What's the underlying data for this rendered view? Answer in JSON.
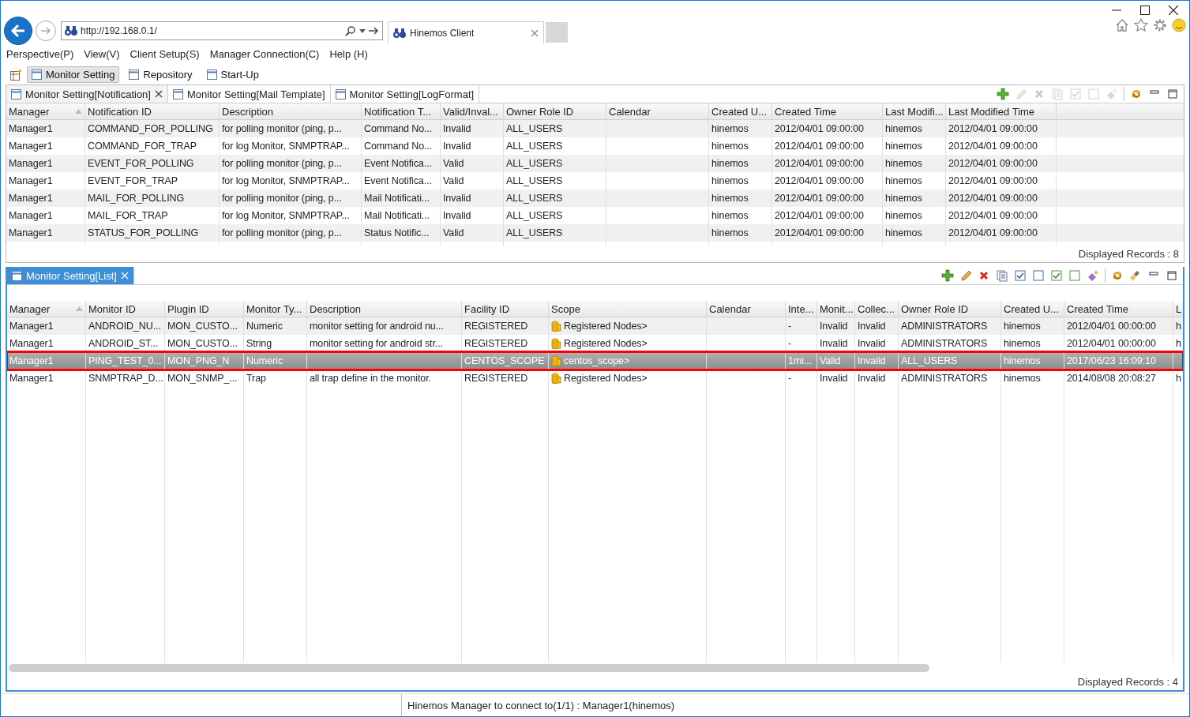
{
  "browser": {
    "url": "http://192.168.0.1/",
    "tab": {
      "title": "Hinemos Client"
    }
  },
  "menu": [
    "Perspective(P)",
    "View(V)",
    "Client Setup(S)",
    "Manager Connection(C)",
    "Help (H)"
  ],
  "perspectives": [
    {
      "label": "Monitor Setting",
      "selected": true
    },
    {
      "label": "Repository",
      "selected": false
    },
    {
      "label": "Start-Up",
      "selected": false
    }
  ],
  "top_view": {
    "active": false,
    "tabs": [
      {
        "label": "Monitor Setting[Notification]",
        "selected": true,
        "closable": true
      },
      {
        "label": "Monitor Setting[Mail Template]",
        "selected": false,
        "closable": false
      },
      {
        "label": "Monitor Setting[LogFormat]",
        "selected": false,
        "closable": false
      }
    ],
    "toolbar": [
      {
        "kind": "add",
        "disabled": false
      },
      {
        "kind": "edit",
        "disabled": true
      },
      {
        "kind": "delete",
        "disabled": true
      },
      {
        "kind": "copy",
        "disabled": true
      },
      {
        "kind": "check",
        "disabled": true
      },
      {
        "kind": "uncheck",
        "disabled": true
      },
      {
        "kind": "diamond",
        "disabled": true
      },
      {
        "kind": "separator"
      },
      {
        "kind": "refresh",
        "disabled": false
      },
      {
        "kind": "minimize",
        "disabled": false
      },
      {
        "kind": "maximize",
        "disabled": false
      }
    ],
    "table": {
      "columns": [
        {
          "label": "Manager",
          "sorted": true
        },
        {
          "label": "Notification ID"
        },
        {
          "label": "Description"
        },
        {
          "label": "Notification T..."
        },
        {
          "label": "Valid/Inval..."
        },
        {
          "label": "Owner Role ID"
        },
        {
          "label": "Calendar"
        },
        {
          "label": "Created U..."
        },
        {
          "label": "Created Time"
        },
        {
          "label": "Last Modifi..."
        },
        {
          "label": "Last Modified Time"
        }
      ],
      "rows": [
        {
          "selected": false,
          "cells": [
            "Manager1",
            "COMMAND_FOR_POLLING",
            "for polling monitor (ping, p...",
            "Command No...",
            "Invalid",
            "ALL_USERS",
            "",
            "hinemos",
            "2012/04/01 09:00:00",
            "hinemos",
            "2012/04/01 09:00:00"
          ]
        },
        {
          "selected": false,
          "cells": [
            "Manager1",
            "COMMAND_FOR_TRAP",
            "for log Monitor, SNMPTRAP...",
            "Command No...",
            "Invalid",
            "ALL_USERS",
            "",
            "hinemos",
            "2012/04/01 09:00:00",
            "hinemos",
            "2012/04/01 09:00:00"
          ]
        },
        {
          "selected": false,
          "cells": [
            "Manager1",
            "EVENT_FOR_POLLING",
            "for polling monitor (ping, p...",
            "Event Notifica...",
            "Valid",
            "ALL_USERS",
            "",
            "hinemos",
            "2012/04/01 09:00:00",
            "hinemos",
            "2012/04/01 09:00:00"
          ]
        },
        {
          "selected": false,
          "cells": [
            "Manager1",
            "EVENT_FOR_TRAP",
            "for log Monitor, SNMPTRAP...",
            "Event Notifica...",
            "Valid",
            "ALL_USERS",
            "",
            "hinemos",
            "2012/04/01 09:00:00",
            "hinemos",
            "2012/04/01 09:00:00"
          ]
        },
        {
          "selected": false,
          "cells": [
            "Manager1",
            "MAIL_FOR_POLLING",
            "for polling monitor (ping, p...",
            "Mail Notificati...",
            "Invalid",
            "ALL_USERS",
            "",
            "hinemos",
            "2012/04/01 09:00:00",
            "hinemos",
            "2012/04/01 09:00:00"
          ]
        },
        {
          "selected": false,
          "cells": [
            "Manager1",
            "MAIL_FOR_TRAP",
            "for log Monitor, SNMPTRAP...",
            "Mail Notificati...",
            "Invalid",
            "ALL_USERS",
            "",
            "hinemos",
            "2012/04/01 09:00:00",
            "hinemos",
            "2012/04/01 09:00:00"
          ]
        },
        {
          "selected": false,
          "cells": [
            "Manager1",
            "STATUS_FOR_POLLING",
            "for polling monitor (ping, p...",
            "Status Notific...",
            "Valid",
            "ALL_USERS",
            "",
            "hinemos",
            "2012/04/01 09:00:00",
            "hinemos",
            "2012/04/01 09:00:00"
          ]
        }
      ]
    },
    "records": "Displayed Records : 8"
  },
  "bottom_view": {
    "active": true,
    "tabs": [
      {
        "label": "Monitor Setting[List]",
        "selected": true,
        "closable": true
      }
    ],
    "toolbar": [
      {
        "kind": "add",
        "disabled": false
      },
      {
        "kind": "edit",
        "disabled": false
      },
      {
        "kind": "delete",
        "disabled": false
      },
      {
        "kind": "copy",
        "disabled": false
      },
      {
        "kind": "check",
        "disabled": false
      },
      {
        "kind": "uncheck",
        "disabled": false
      },
      {
        "kind": "tick-box",
        "disabled": false
      },
      {
        "kind": "empty-square",
        "disabled": false
      },
      {
        "kind": "diamond",
        "disabled": false
      },
      {
        "kind": "separator"
      },
      {
        "kind": "refresh",
        "disabled": false
      },
      {
        "kind": "broom",
        "disabled": false
      },
      {
        "kind": "minimize",
        "disabled": false
      },
      {
        "kind": "maximize",
        "disabled": false
      }
    ],
    "table": {
      "columns": [
        {
          "label": "Manager",
          "sorted": true
        },
        {
          "label": "Monitor ID"
        },
        {
          "label": "Plugin ID"
        },
        {
          "label": "Monitor Ty..."
        },
        {
          "label": "Description"
        },
        {
          "label": "Facility ID"
        },
        {
          "label": "Scope",
          "kind": "scope"
        },
        {
          "label": "Calendar"
        },
        {
          "label": "Inte..."
        },
        {
          "label": "Monit..."
        },
        {
          "label": "Collec..."
        },
        {
          "label": "Owner Role ID"
        },
        {
          "label": "Created U..."
        },
        {
          "label": "Created Time"
        },
        {
          "label": "L"
        }
      ],
      "rows": [
        {
          "selected": false,
          "highlighted": false,
          "cells": [
            "Manager1",
            "ANDROID_NU...",
            "MON_CUSTO...",
            "Numeric",
            "monitor setting for android nu...",
            "REGISTERED",
            "Registered Nodes>",
            "",
            "-",
            "Invalid",
            "Invalid",
            "ADMINISTRATORS",
            "hinemos",
            "2012/04/01 00:00:00",
            "h"
          ]
        },
        {
          "selected": false,
          "highlighted": false,
          "cells": [
            "Manager1",
            "ANDROID_ST...",
            "MON_CUSTO...",
            "String",
            "monitor setting for android str...",
            "REGISTERED",
            "Registered Nodes>",
            "",
            "-",
            "Invalid",
            "Invalid",
            "ADMINISTRATORS",
            "hinemos",
            "2012/04/01 00:00:00",
            "h"
          ]
        },
        {
          "selected": true,
          "highlighted": true,
          "cells": [
            "Manager1",
            "PING_TEST_0...",
            "MON_PNG_N",
            "Numeric",
            "",
            "CENTOS_SCOPE",
            "centos_scope>",
            "",
            "1mi...",
            "Valid",
            "Invalid",
            "ALL_USERS",
            "hinemos",
            "2017/06/23 16:09:10",
            ""
          ]
        },
        {
          "selected": false,
          "highlighted": false,
          "cells": [
            "Manager1",
            "SNMPTRAP_D...",
            "MON_SNMP_...",
            "Trap",
            "all trap define in the monitor.",
            "REGISTERED",
            "Registered Nodes>",
            "",
            "-",
            "Invalid",
            "Invalid",
            "ADMINISTRATORS",
            "hinemos",
            "2014/08/08 20:08:27",
            "h"
          ]
        }
      ]
    },
    "records": "Displayed Records : 4"
  },
  "status_bar": "Hinemos Manager to connect to(1/1) : Manager1(hinemos)"
}
